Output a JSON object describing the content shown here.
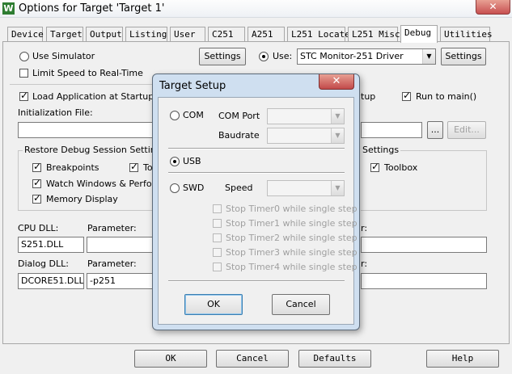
{
  "window": {
    "title": "Options for Target 'Target 1'",
    "icon_letter": "W",
    "close_glyph": "✕"
  },
  "tabs": [
    {
      "label": "Device"
    },
    {
      "label": "Target"
    },
    {
      "label": "Output"
    },
    {
      "label": "Listing"
    },
    {
      "label": "User"
    },
    {
      "label": "C251"
    },
    {
      "label": "A251"
    },
    {
      "label": "L251 Locate"
    },
    {
      "label": "L251 Misc"
    },
    {
      "label": "Debug"
    },
    {
      "label": "Utilities"
    }
  ],
  "active_tab": "Debug",
  "left": {
    "use_simulator_label": "Use Simulator",
    "limit_speed_label": "Limit Speed to Real-Time",
    "settings_label": "Settings",
    "load_app_label": "Load Application at Startup",
    "init_file_label": "Initialization File:",
    "restore_group_title": "Restore Debug Session Settings",
    "breakpoints_label": "Breakpoints",
    "toolbox_partial": "To",
    "watch_windows_label": "Watch Windows & Performa",
    "memory_display_label": "Memory Display",
    "cpu_dll_label": "CPU DLL:",
    "cpu_param_label": "Parameter:",
    "cpu_dll_value": "S251.DLL",
    "dialog_dll_label": "Dialog DLL:",
    "dialog_param_label": "Parameter:",
    "dialog_dll_value": "DCORE51.DLL",
    "dialog_param_value": "-p251"
  },
  "right": {
    "use_label": "Use:",
    "driver_value": "STC Monitor-251 Driver",
    "settings_label": "Settings",
    "startup_partial": "tup",
    "run_to_main_label": "Run to main()",
    "browse_label": "...",
    "edit_label": "Edit...",
    "settings_group_partial": "Settings",
    "toolbox_label": "Toolbox",
    "param_partial_1": "r:",
    "param_partial_2": "r:"
  },
  "footer": {
    "ok_label": "OK",
    "cancel_label": "Cancel",
    "defaults_label": "Defaults",
    "help_label": "Help"
  },
  "dialog": {
    "title": "Target Setup",
    "close_glyph": "✕",
    "com_label": "COM",
    "com_port_label": "COM Port",
    "baudrate_label": "Baudrate",
    "usb_label": "USB",
    "swd_label": "SWD",
    "speed_label": "Speed",
    "stop_timers": [
      {
        "label": "Stop Timer0 while single step"
      },
      {
        "label": "Stop Timer1 while single step"
      },
      {
        "label": "Stop Timer2 while single step"
      },
      {
        "label": "Stop Timer3 while single step"
      },
      {
        "label": "Stop Timer4 while single step"
      }
    ],
    "ok_label": "OK",
    "cancel_label": "Cancel",
    "selected_interface": "USB"
  }
}
